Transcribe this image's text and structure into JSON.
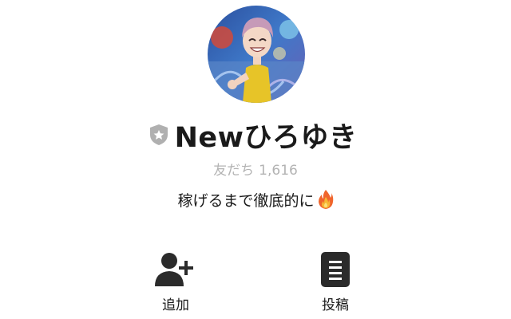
{
  "profile": {
    "avatar": "avatar-image",
    "badge_icon": "shield-star-icon",
    "name": "Newひろゆき",
    "friends_label": "友だち",
    "friends_count": "1,616",
    "status_message": "稼げるまで徹底的に",
    "status_emoji_icon": "fire-icon"
  },
  "actions": {
    "add": {
      "label": "追加",
      "icon": "add-friend-icon"
    },
    "post": {
      "label": "投稿",
      "icon": "posts-icon"
    }
  },
  "colors": {
    "text": "#1a1a1a",
    "muted": "#b3b3b3",
    "badge": "#b0b0b0",
    "icon": "#2b2b2b"
  }
}
